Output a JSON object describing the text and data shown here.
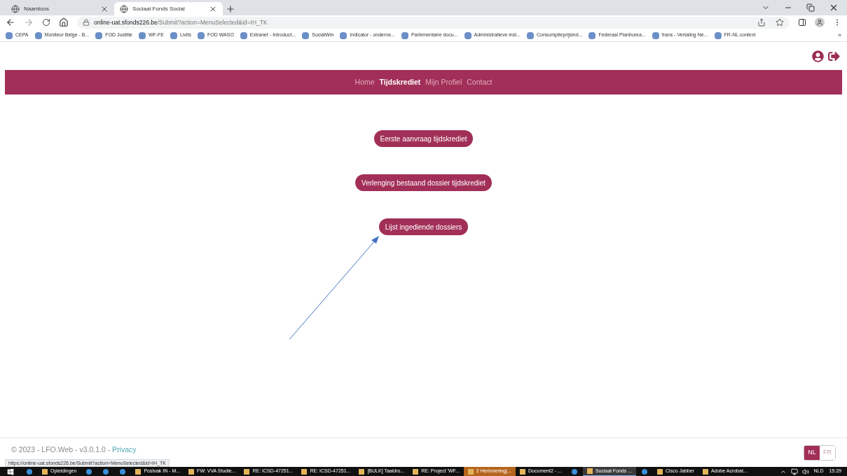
{
  "browser": {
    "tabs": [
      {
        "title": "Naamloos",
        "selected": false
      },
      {
        "title": "Sociaal Fonds Social",
        "selected": true
      }
    ],
    "address": {
      "host": "online-uat.sfonds226.be",
      "path": "/Submit?action=MenuSelected&id=IH_TK"
    },
    "bookmarks": [
      "CEPA",
      "Moniteur Belge - B...",
      "FOD Justitie",
      "WF-FE",
      "Livits",
      "FOD WASO",
      "Extranet - Introduct...",
      "SocialWin",
      "Indicator - onderne...",
      "Parlementaire docu...",
      "Administratieve inst...",
      "Consumptieprijsind...",
      "Federaal Planburea...",
      "frans - Vertaling Ne...",
      "FR-NL context"
    ],
    "bookmarks_more": "»"
  },
  "site": {
    "nav": [
      {
        "label": "Home",
        "selected": false
      },
      {
        "label": "Tijdskrediet",
        "selected": true
      },
      {
        "label": "Mijn Profiel",
        "selected": false
      },
      {
        "label": "Contact",
        "selected": false
      }
    ],
    "actions": [
      "Eerste aanvraag tijdskrediet",
      "Verlenging bestaand dossier tijdskrediet",
      "Lijst ingediende dossiers"
    ],
    "footer": {
      "text": "© 2023 - LFO.Web - v3.0.1.0 - ",
      "link": "Privacy"
    },
    "languages": [
      {
        "label": "NL",
        "selected": true
      },
      {
        "label": "FR",
        "selected": false
      }
    ]
  },
  "status_url": "https://online-uat.sfonds226.be/Submit?action=MenuSelected&id=IH_TK",
  "taskbar": {
    "items": [
      {
        "kind": "pinned",
        "selected": false,
        "alert": false
      },
      {
        "kind": "app",
        "label": "Opleidingen",
        "selected": false,
        "alert": false
      },
      {
        "kind": "pinned",
        "selected": false,
        "alert": false
      },
      {
        "kind": "pinned",
        "selected": false,
        "alert": false
      },
      {
        "kind": "pinned",
        "selected": false,
        "alert": false
      },
      {
        "kind": "app",
        "label": "Postvak IN - M...",
        "selected": false,
        "alert": false
      },
      {
        "kind": "app",
        "label": "FW: VVA Studie...",
        "selected": false,
        "alert": false
      },
      {
        "kind": "app",
        "label": "RE: ICSD-47251...",
        "selected": false,
        "alert": false
      },
      {
        "kind": "app",
        "label": "RE: ICSD-47251...",
        "selected": false,
        "alert": false
      },
      {
        "kind": "app",
        "label": "[BULK] Taaldro...",
        "selected": false,
        "alert": false
      },
      {
        "kind": "app",
        "label": "RE: Project 'WF...",
        "selected": false,
        "alert": false
      },
      {
        "kind": "app",
        "label": "2 Herinnering(...",
        "selected": false,
        "alert": true
      },
      {
        "kind": "app",
        "label": "Document2 - ...",
        "selected": false,
        "alert": false
      },
      {
        "kind": "pinned",
        "selected": false,
        "alert": false
      },
      {
        "kind": "app",
        "label": "Sociaal Fonds ...",
        "selected": true,
        "alert": false
      },
      {
        "kind": "pinned",
        "selected": false,
        "alert": false
      },
      {
        "kind": "app",
        "label": "Cisco Jabber",
        "selected": false,
        "alert": false
      },
      {
        "kind": "app",
        "label": "Adobe Acrobat...",
        "selected": false,
        "alert": false
      }
    ],
    "language": "NLD",
    "time": "15:29"
  }
}
